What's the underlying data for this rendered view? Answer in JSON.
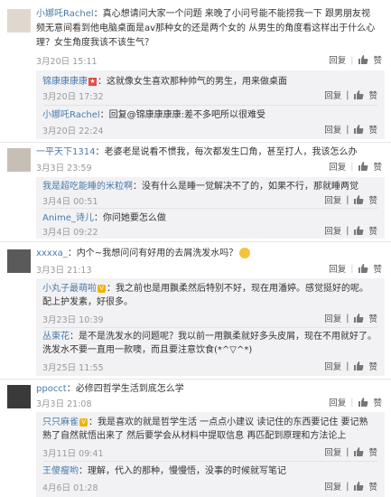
{
  "like_label": "赞",
  "reply_label": "回复",
  "comments": [
    {
      "user": "小娜吒Rachel",
      "text": "：真心想请问大家一个问题  来晚了小问号能不能捞我一下 跟男朋友视频无意间看到他电脑桌面是av那种女的还是两个女的  从男生的角度看这样出于什么心理？女生角度我该不该生气？",
      "time": "3月20日 15:11",
      "replies": [
        {
          "user": "锦康康康康",
          "badge": "★",
          "text": "：这就像女生喜欢那种帅气的男生，用来做桌面",
          "time": "3月20日 17:32"
        },
        {
          "user": "小娜吒Rachel",
          "text": "：回复@锦康康康康:差不多吧所以很难受",
          "time": "3月20日 22:24"
        }
      ]
    },
    {
      "user": "一平天下1314",
      "text": "：老婆老是说看不惯我，每次都发生口角，甚至打人，我该怎么办",
      "time": "3月3日 23:59",
      "replies": [
        {
          "user": "我是超吃能睡的米粒啊",
          "text": "：没有什么是睡一觉解决不了的，如果不行，那就睡两觉",
          "time": "3月4日 00:51"
        },
        {
          "user": "Anime_诗儿",
          "text": "：你问她要怎么做",
          "time": "3月4日 09:22"
        }
      ]
    },
    {
      "user": "xxxxa_",
      "text": "：内个~我想问问有好用的去屑洗发水吗？",
      "emoji": "laugh-emoji",
      "time": "3月3日 21:13",
      "replies": [
        {
          "user": "小丸子最萌啦",
          "badge": "V",
          "text": "：我之前也是用飘柔然后特别不好，现在用潘婷。感觉挺好的呢。配上护发素，好很多。",
          "time": "3月23日 10:39"
        },
        {
          "user": "丛東花",
          "text": "：是不是洗发水的问题呢？我以前一用飘柔就好多头皮屑，现在不用就好了。洗发水不要一直用一款噢，而且要注意饮食(*^▽^*)",
          "time": "3月25日 11:55"
        }
      ]
    },
    {
      "user": "ppocct",
      "text": "：必修四哲学生活到底怎么学",
      "time": "3月3日 21:08",
      "replies": [
        {
          "user": "只只麻雀",
          "badge": "V",
          "text": "：我是喜欢的就是哲学生活  一点点小建议 读记住的东西要记住 要记熟 熟了自然就悟出来了 然后要学会从材料中提取信息 再匹配到原理和方法论上",
          "time": "3月11日 09:41"
        },
        {
          "user": "王傻瘦哟",
          "text": "：理解，代入的那种，慢慢悟，没事的时候就写笔记",
          "time": "4月6日 01:28"
        }
      ]
    }
  ]
}
